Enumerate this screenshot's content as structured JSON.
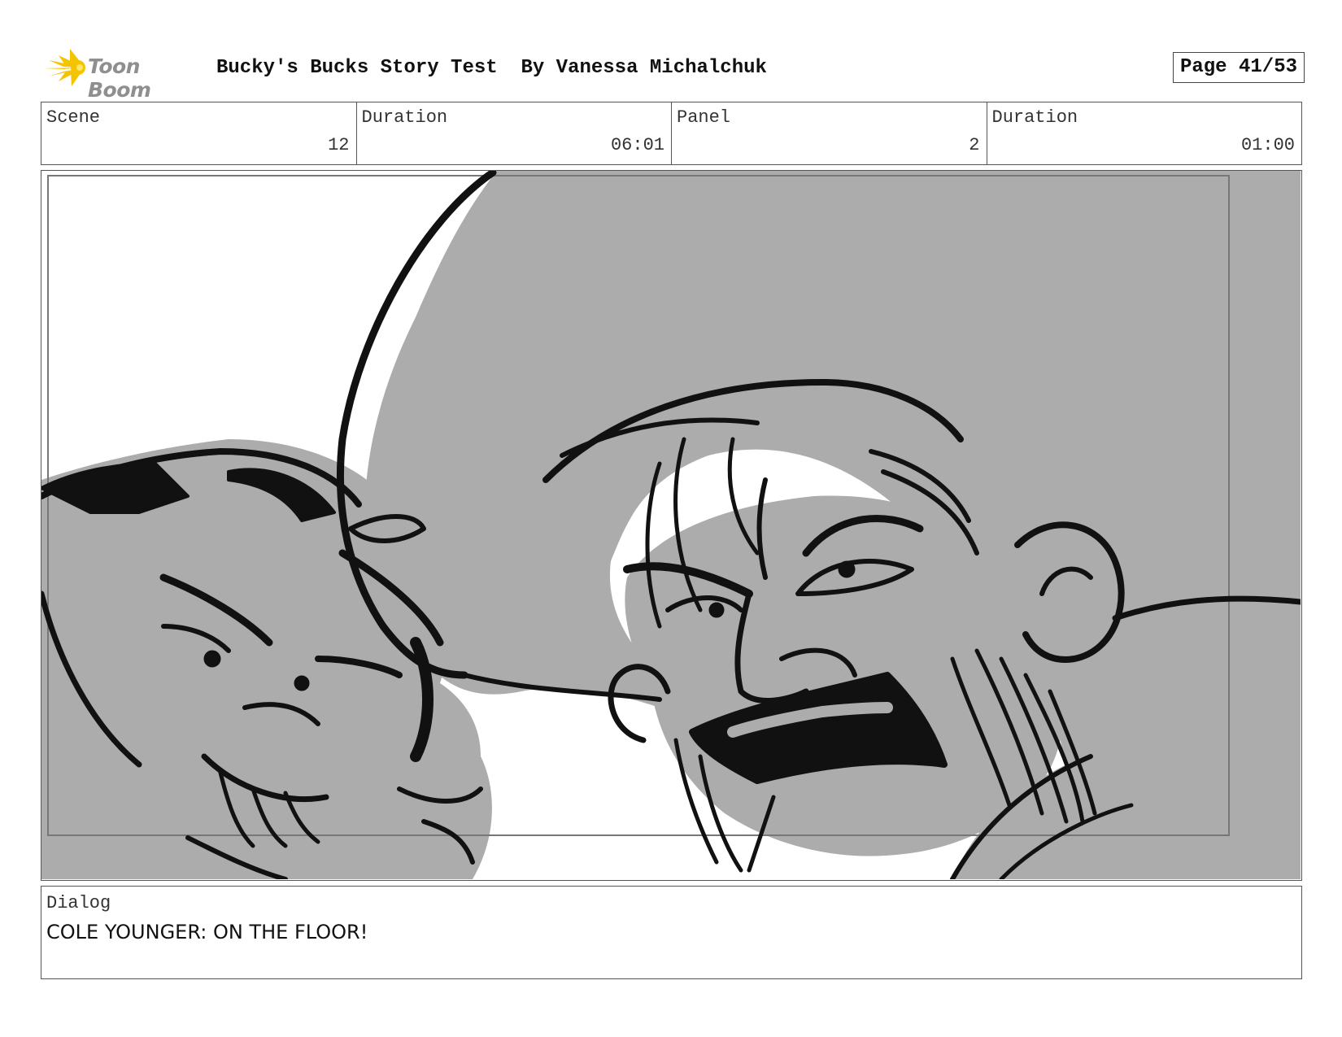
{
  "header": {
    "logo_text": "Toon Boom",
    "title": "Bucky's Bucks Story Test  By Vanessa Michalchuk",
    "page": "Page 41/53"
  },
  "info": {
    "scene_label": "Scene",
    "scene_value": "12",
    "scene_duration_label": "Duration",
    "scene_duration_value": "06:01",
    "panel_label": "Panel",
    "panel_value": "2",
    "panel_duration_label": "Duration",
    "panel_duration_value": "01:00"
  },
  "dialog": {
    "label": "Dialog",
    "text": "COLE YOUNGER: ON THE FLOOR!"
  },
  "colors": {
    "fill_gray": "#acacac",
    "line": "#111111",
    "logo_yellow": "#f5c400"
  }
}
